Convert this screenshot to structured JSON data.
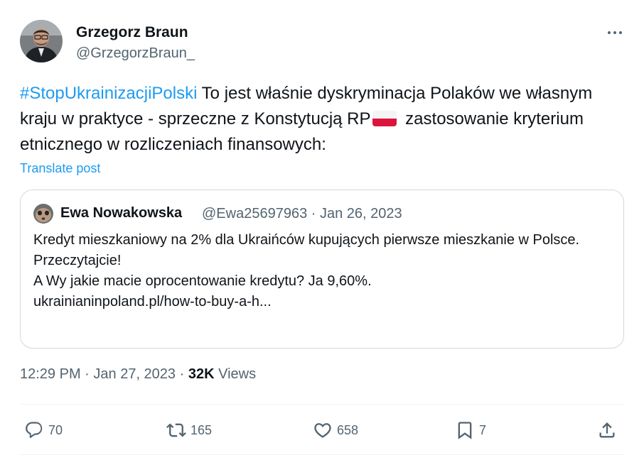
{
  "author": {
    "name": "Grzegorz Braun",
    "handle": "@GrzegorzBraun_"
  },
  "tweet": {
    "hashtag": "#StopUkrainizacjiPolski",
    "text_part1": " To jest właśnie dyskryminacja Polaków we własnym kraju w praktyce - sprzeczne z Konstytucją RP",
    "text_part2": " zastosowanie kryterium etnicznego w rozliczeniach finansowych:",
    "translate_label": "Translate post"
  },
  "quote": {
    "name": "Ewa Nowakowska",
    "handle": "@Ewa25697963",
    "date": "Jan 26, 2023",
    "lines": [
      "Kredyt mieszkaniowy na 2% dla Ukraińców kupujących pierwsze mieszkanie w Polsce.",
      "Przeczytajcie!",
      "A Wy jakie macie oprocentowanie kredytu? Ja 9,60%.",
      "ukrainianinpoland.pl/how-to-buy-a-h..."
    ]
  },
  "meta": {
    "time": "12:29 PM",
    "date": "Jan 27, 2023",
    "views_count": "32K",
    "views_label": "Views"
  },
  "actions": {
    "replies": "70",
    "reposts": "165",
    "likes": "658",
    "bookmarks": "7"
  },
  "colors": {
    "accent": "#1d9bf0",
    "text": "#0f1419",
    "secondary": "#536471",
    "border": "#cfd9de"
  },
  "icons": [
    "more-icon",
    "reply-icon",
    "repost-icon",
    "like-icon",
    "bookmark-icon",
    "share-icon",
    "poland-flag-icon"
  ]
}
